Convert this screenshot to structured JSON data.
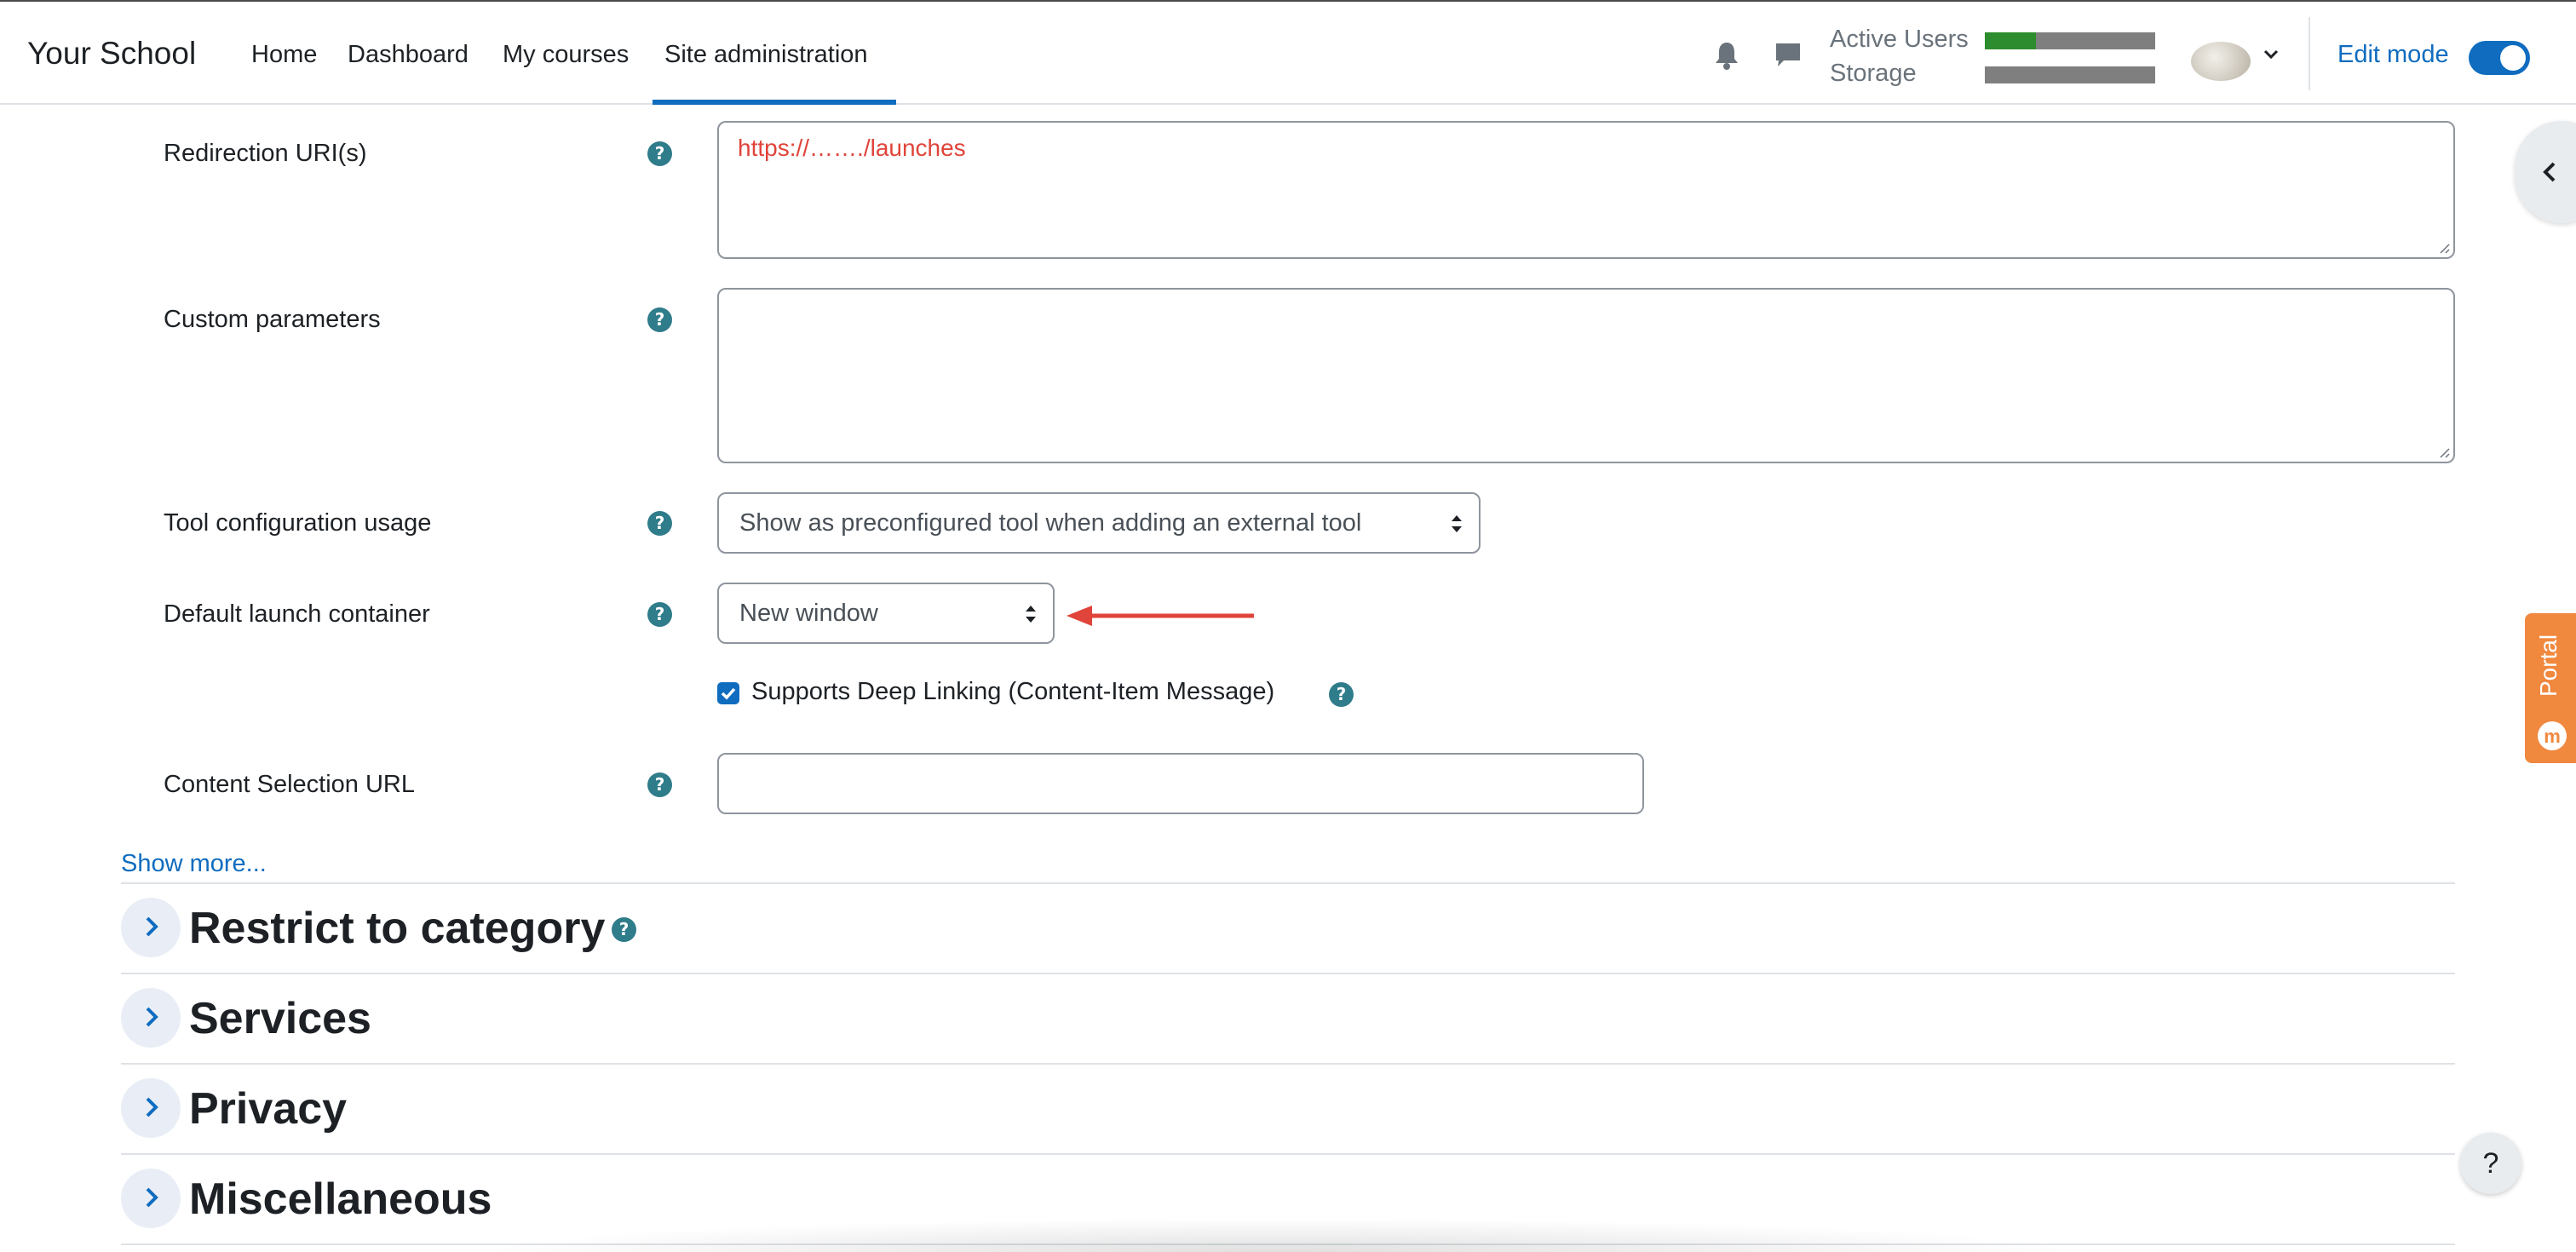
{
  "navbar": {
    "brand": "Your School",
    "items": [
      {
        "label": "Home"
      },
      {
        "label": "Dashboard"
      },
      {
        "label": "My courses"
      },
      {
        "label": "Site administration",
        "active": true
      }
    ],
    "icons": [
      "bell-icon",
      "chat-icon"
    ],
    "usage": {
      "active_users_label": "Active Users",
      "active_users_fraction": 0.3,
      "storage_label": "Storage",
      "storage_fraction": 0.0
    },
    "edit_mode_label": "Edit mode",
    "edit_mode_on": true
  },
  "form": {
    "redirection": {
      "label": "Redirection URI(s)",
      "value": "https://……./launches",
      "value_color": "#e0443a"
    },
    "custom_params": {
      "label": "Custom parameters",
      "value": ""
    },
    "tool_usage": {
      "label": "Tool configuration usage",
      "selected": "Show as preconfigured tool when adding an external tool"
    },
    "launch_container": {
      "label": "Default launch container",
      "selected": "New window"
    },
    "deep_linking": {
      "label": "Supports Deep Linking (Content-Item Message)",
      "checked": true
    },
    "content_selection": {
      "label": "Content Selection URL",
      "value": ""
    },
    "help_glyph": "?"
  },
  "show_more": "Show more...",
  "sections": [
    {
      "title": "Restrict to category"
    },
    {
      "title": "Services"
    },
    {
      "title": "Privacy"
    },
    {
      "title": "Miscellaneous"
    }
  ],
  "portal_label": "Portal",
  "help_fab": "?",
  "colors": {
    "accent": "#0f6cbf",
    "help": "#2f7c8a",
    "annotation_arrow": "#e0443a",
    "portal": "#f0883e"
  }
}
